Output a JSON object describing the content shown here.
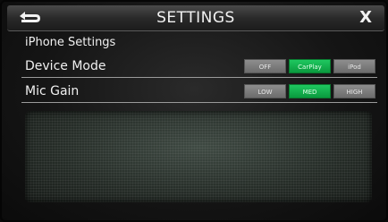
{
  "header": {
    "title": "SETTINGS",
    "close_label": "X",
    "back_icon": "back-arrow-icon"
  },
  "section": {
    "title": "iPhone Settings"
  },
  "settings": [
    {
      "label": "Device Mode",
      "options": [
        "OFF",
        "CarPlay",
        "iPod"
      ],
      "selected": "CarPlay"
    },
    {
      "label": "Mic Gain",
      "options": [
        "LOW",
        "MED",
        "HIGH"
      ],
      "selected": "MED"
    }
  ],
  "colors": {
    "selected": "#12b04e",
    "unselected": "#7d7d7d",
    "text": "#f0f0f0"
  }
}
